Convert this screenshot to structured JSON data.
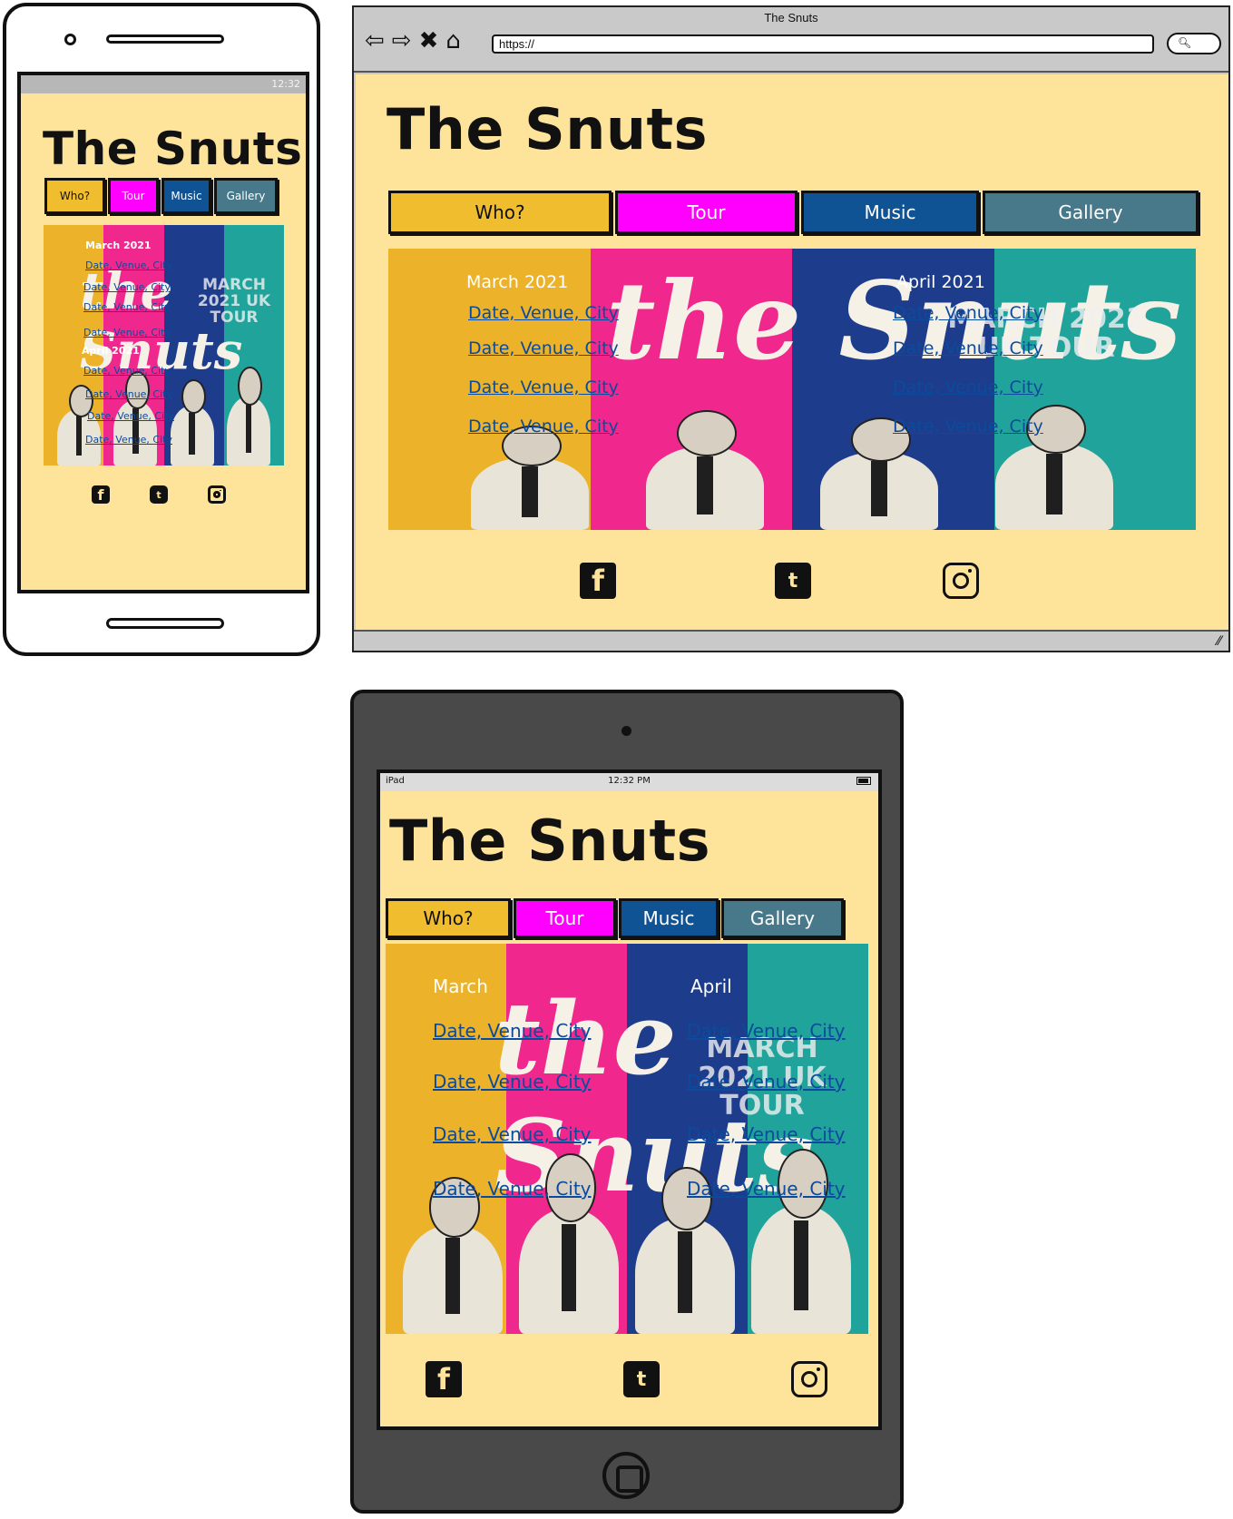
{
  "site": {
    "title": "The Snuts",
    "nav": [
      "Who?",
      "Tour",
      "Music",
      "Gallery"
    ],
    "poster_text": "MARCH 2021 UK TOUR",
    "logo_script": "the Snuts"
  },
  "phone": {
    "status_time": "12:32",
    "month_1": "March 2021",
    "month_2": "April 2021",
    "gigs_1": [
      "Date, Venue, City",
      "Date, Venue, City",
      "Date, Venue, City",
      "Date, Venue, City"
    ],
    "gigs_2": [
      "Date, Venue, City",
      "Date, Venue, City",
      "Date, Venue, City",
      "Date, Venue, City"
    ]
  },
  "browser": {
    "window_title": "The Snuts",
    "url": "https://",
    "month_1": "March 2021",
    "month_2": "April 2021",
    "gigs_1": [
      "Date, Venue, City",
      "Date, Venue, City",
      "Date, Venue, City",
      "Date, Venue, City"
    ],
    "gigs_2": [
      "Date, Venue, City",
      "Date, Venue, City",
      "Date, Venue, City",
      "Date, Venue, City"
    ]
  },
  "tablet": {
    "status_device": "iPad",
    "status_time": "12:32 PM",
    "month_1": "March",
    "month_2": "April",
    "gigs_1": [
      "Date, Venue, City",
      "Date, Venue, City",
      "Date, Venue, City",
      "Date, Venue, City"
    ],
    "gigs_2": [
      "Date, Venue, City",
      "Date, Venue, City",
      "Date, Venue, City",
      "Date, Venue, City"
    ]
  },
  "icons": {
    "facebook": "facebook-icon",
    "twitter": "twitter-icon",
    "instagram": "instagram-icon"
  },
  "colors": {
    "page_bg": "#fee49b",
    "who": "#f0bd2e",
    "tour": "#ff00ff",
    "music": "#0f5394",
    "gallery": "#47798a",
    "link": "#0c4b9b"
  }
}
